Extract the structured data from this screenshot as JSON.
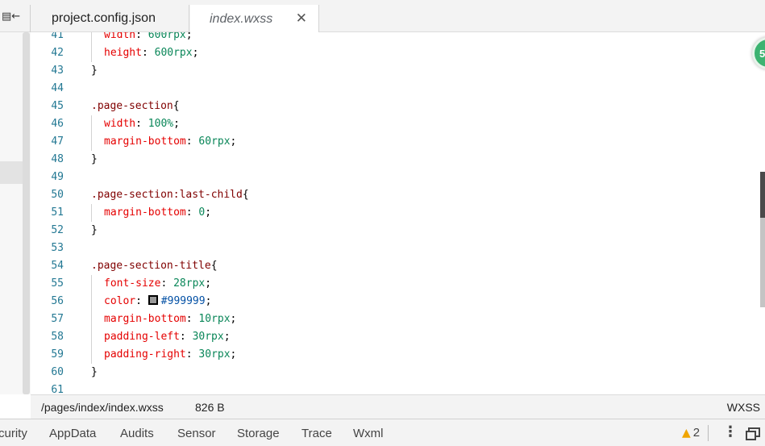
{
  "tabs": [
    {
      "label": "project.config.json",
      "active": false
    },
    {
      "label": "index.wxss",
      "active": true,
      "close_icon": "close-icon"
    }
  ],
  "toggle_icon": "panel-collapse-icon",
  "badge": "5",
  "editor": {
    "lines": [
      {
        "n": "41",
        "parts": [
          [
            "prop",
            "width"
          ],
          [
            "punc",
            ": "
          ],
          [
            "num",
            "600"
          ],
          [
            "unit",
            "rpx"
          ],
          [
            "punc",
            ";"
          ]
        ],
        "indent": true
      },
      {
        "n": "42",
        "parts": [
          [
            "prop",
            "height"
          ],
          [
            "punc",
            ": "
          ],
          [
            "num",
            "600"
          ],
          [
            "unit",
            "rpx"
          ],
          [
            "punc",
            ";"
          ]
        ],
        "indent": true
      },
      {
        "n": "43",
        "parts": [
          [
            "punc",
            "}"
          ]
        ],
        "indent": false
      },
      {
        "n": "44",
        "parts": [],
        "indent": false
      },
      {
        "n": "45",
        "parts": [
          [
            "sel",
            ".page-section"
          ],
          [
            "punc",
            "{"
          ]
        ],
        "indent": false
      },
      {
        "n": "46",
        "parts": [
          [
            "prop",
            "width"
          ],
          [
            "punc",
            ": "
          ],
          [
            "num",
            "100%"
          ],
          [
            "punc",
            ";"
          ]
        ],
        "indent": true
      },
      {
        "n": "47",
        "parts": [
          [
            "prop",
            "margin-bottom"
          ],
          [
            "punc",
            ": "
          ],
          [
            "num",
            "60"
          ],
          [
            "unit",
            "rpx"
          ],
          [
            "punc",
            ";"
          ]
        ],
        "indent": true
      },
      {
        "n": "48",
        "parts": [
          [
            "punc",
            "}"
          ]
        ],
        "indent": false
      },
      {
        "n": "49",
        "parts": [],
        "indent": false
      },
      {
        "n": "50",
        "parts": [
          [
            "sel",
            ".page-section:last-child"
          ],
          [
            "punc",
            "{"
          ]
        ],
        "indent": false
      },
      {
        "n": "51",
        "parts": [
          [
            "prop",
            "margin-bottom"
          ],
          [
            "punc",
            ": "
          ],
          [
            "num",
            "0"
          ],
          [
            "punc",
            ";"
          ]
        ],
        "indent": true
      },
      {
        "n": "52",
        "parts": [
          [
            "punc",
            "}"
          ]
        ],
        "indent": false
      },
      {
        "n": "53",
        "parts": [],
        "indent": false
      },
      {
        "n": "54",
        "parts": [
          [
            "sel",
            ".page-section-title"
          ],
          [
            "punc",
            "{"
          ]
        ],
        "indent": false
      },
      {
        "n": "55",
        "parts": [
          [
            "prop",
            "font-size"
          ],
          [
            "punc",
            ": "
          ],
          [
            "num",
            "28"
          ],
          [
            "unit",
            "rpx"
          ],
          [
            "punc",
            ";"
          ]
        ],
        "indent": true
      },
      {
        "n": "56",
        "parts": [
          [
            "prop",
            "color"
          ],
          [
            "punc",
            ": "
          ],
          [
            "swatch",
            "#999999"
          ],
          [
            "hex",
            "#999999"
          ],
          [
            "punc",
            ";"
          ]
        ],
        "indent": true
      },
      {
        "n": "57",
        "parts": [
          [
            "prop",
            "margin-bottom"
          ],
          [
            "punc",
            ": "
          ],
          [
            "num",
            "10"
          ],
          [
            "unit",
            "rpx"
          ],
          [
            "punc",
            ";"
          ]
        ],
        "indent": true
      },
      {
        "n": "58",
        "parts": [
          [
            "prop",
            "padding-left"
          ],
          [
            "punc",
            ": "
          ],
          [
            "num",
            "30"
          ],
          [
            "unit",
            "rpx"
          ],
          [
            "punc",
            ";"
          ]
        ],
        "indent": true
      },
      {
        "n": "59",
        "parts": [
          [
            "prop",
            "padding-right"
          ],
          [
            "punc",
            ": "
          ],
          [
            "num",
            "30"
          ],
          [
            "unit",
            "rpx"
          ],
          [
            "punc",
            ";"
          ]
        ],
        "indent": true
      },
      {
        "n": "60",
        "parts": [
          [
            "punc",
            "}"
          ]
        ],
        "indent": false
      },
      {
        "n": "61",
        "parts": [],
        "indent": false
      }
    ]
  },
  "status": {
    "path": "/pages/index/index.wxss",
    "size": "826 B",
    "language": "WXSS"
  },
  "devtools_tabs": [
    "curity",
    "AppData",
    "Audits",
    "Sensor",
    "Storage",
    "Trace",
    "Wxml"
  ],
  "warnings": {
    "count": "2",
    "icon": "warning-icon"
  },
  "colors": {
    "line_number": "#237893",
    "property": "#e50000",
    "selector": "#800000",
    "number": "#098658",
    "hex": "#0451a5"
  }
}
